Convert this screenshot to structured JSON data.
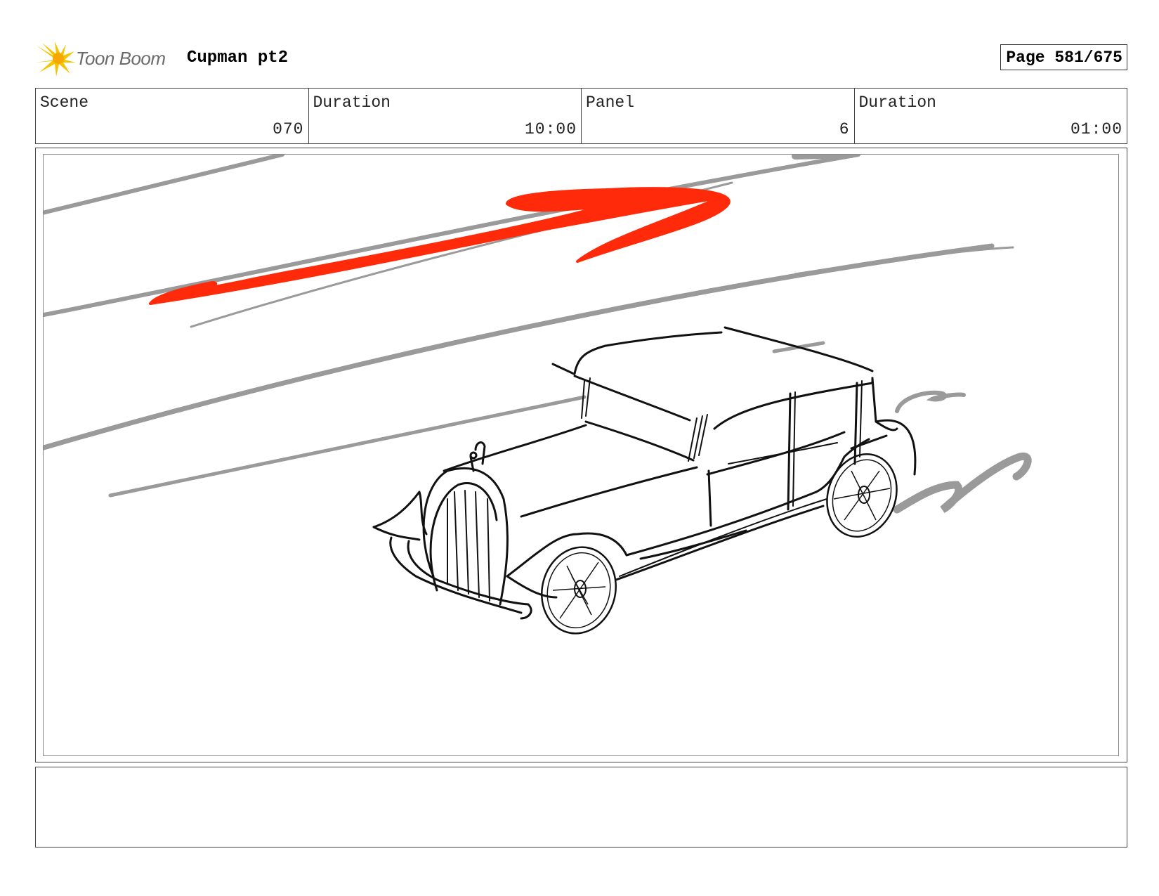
{
  "header": {
    "logo_text": "Toon Boom",
    "project_title": "Cupman pt2",
    "page_label": "Page 581/675"
  },
  "info": {
    "scene_label": "Scene",
    "scene_value": "070",
    "scene_duration_label": "Duration",
    "scene_duration_value": "10:00",
    "panel_label": "Panel",
    "panel_value": "6",
    "panel_duration_label": "Duration",
    "panel_duration_value": "01:00"
  },
  "colors": {
    "arrow": "#ff2a0a",
    "speed_lines": "#9a9a9a",
    "ink": "#111111",
    "logo_star": "#f5c400"
  },
  "icons": {
    "logo": "toon-boom-star-icon"
  },
  "notes": ""
}
